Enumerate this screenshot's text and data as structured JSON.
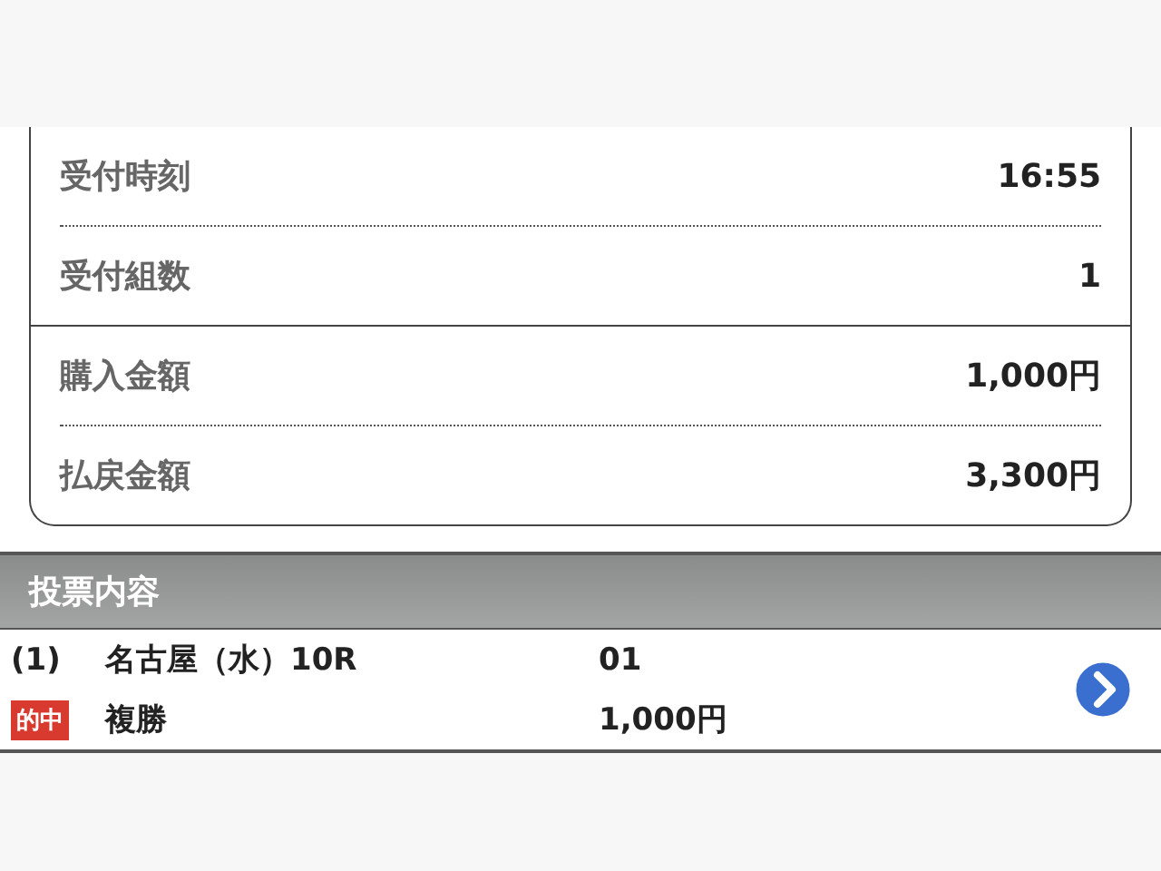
{
  "summary": {
    "groups": [
      {
        "rows": [
          {
            "label": "受付時刻",
            "value": "16:55"
          },
          {
            "label": "受付組数",
            "value": "1"
          }
        ]
      },
      {
        "rows": [
          {
            "label": "購入金額",
            "value": "1,000円"
          },
          {
            "label": "払戻金額",
            "value": "3,300円"
          }
        ]
      }
    ]
  },
  "bets": {
    "title": "投票内容",
    "items": [
      {
        "number": "(1)",
        "race": "名古屋（水）10R",
        "combination": "01",
        "badge": "的中",
        "bet_type": "複勝",
        "amount": "1,000円"
      }
    ]
  }
}
